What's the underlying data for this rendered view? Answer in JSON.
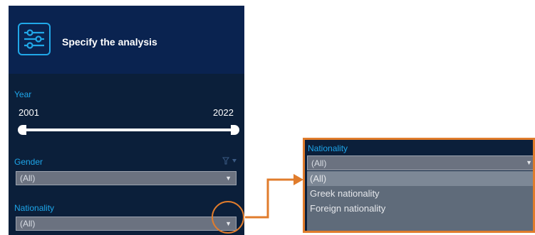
{
  "header": {
    "title": "Specify the analysis",
    "icon": "sliders-icon"
  },
  "year": {
    "label": "Year",
    "min": "2001",
    "max": "2022",
    "range": [
      2001,
      2022
    ]
  },
  "gender": {
    "label": "Gender",
    "value": "(All)"
  },
  "nationality": {
    "label": "Nationality",
    "value": "(All)"
  },
  "popup": {
    "label": "Nationality",
    "selected": "(All)",
    "options": [
      "(All)",
      "Greek nationality",
      "Foreign nationality"
    ]
  },
  "colors": {
    "panel_bg": "#0b1f3a",
    "header_bg": "#0a2350",
    "accent": "#1ea6ea",
    "callout": "#e07c2c"
  }
}
